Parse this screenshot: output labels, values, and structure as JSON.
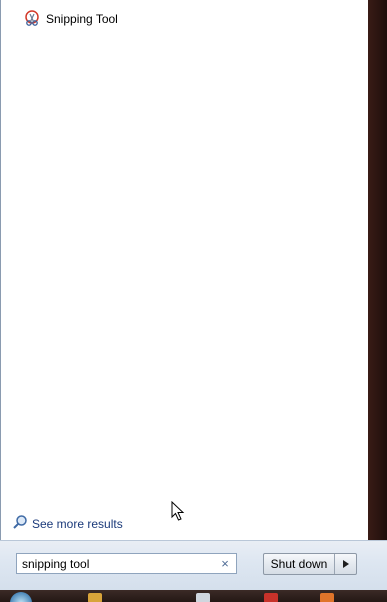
{
  "results": {
    "programs": [
      {
        "label": "Snipping Tool",
        "icon": "scissors-icon"
      }
    ],
    "see_more_label": "See more results"
  },
  "search": {
    "value": "snipping tool",
    "clear_label": "×"
  },
  "power": {
    "shutdown_label": "Shut down",
    "arrow_icon": "triangle-right-icon"
  },
  "colors": {
    "menu_background": "#ffffff",
    "bottom_bar": "#dde6f1",
    "link_text": "#1b3a7a",
    "taskbar": "#2a1c18"
  }
}
